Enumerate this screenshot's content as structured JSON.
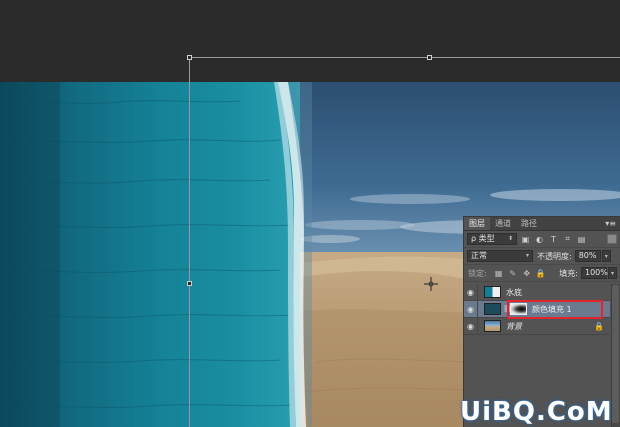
{
  "panel": {
    "tabs": [
      {
        "label": "图层"
      },
      {
        "label": "通道"
      },
      {
        "label": "路径"
      }
    ],
    "menu_icon": "panel-menu-icon",
    "filter": {
      "kind_label": "ρ 类型",
      "icons": [
        "image-filter-icon",
        "adjustment-filter-icon",
        "text-filter-icon",
        "shape-filter-icon",
        "smart-object-filter-icon"
      ]
    },
    "blend_mode": "正常",
    "opacity_label": "不透明度:",
    "opacity_value": "80%",
    "lock_label": "锁定:",
    "fill_label": "填充:",
    "fill_value": "100%",
    "layers": [
      {
        "name": "水底",
        "visible": true,
        "selected": false
      },
      {
        "name": "颜色填充 1",
        "visible": true,
        "selected": true
      },
      {
        "name": "背景",
        "visible": true,
        "selected": false,
        "locked": true
      }
    ]
  },
  "watermark": {
    "text": "UiBQ.CoM"
  },
  "colors": {
    "highlight": "#e3262d",
    "selected_row": "#6c7a8f",
    "guide": "#31c11b"
  }
}
